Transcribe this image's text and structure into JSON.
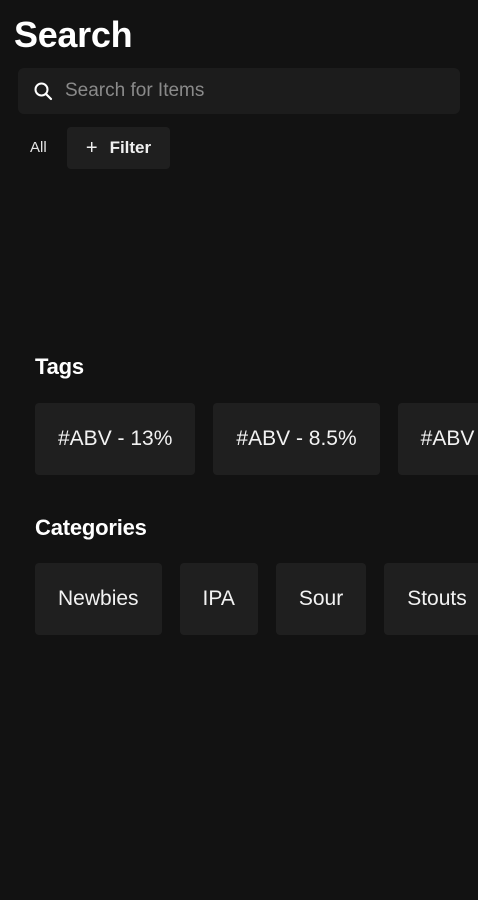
{
  "header": {
    "title": "Search"
  },
  "search": {
    "placeholder": "Search for Items",
    "value": ""
  },
  "filters": {
    "all_label": "All",
    "filter_label": "Filter"
  },
  "tags": {
    "title": "Tags",
    "items": [
      "#ABV - 13%",
      "#ABV - 8.5%",
      "#ABV"
    ]
  },
  "categories": {
    "title": "Categories",
    "items": [
      "Newbies",
      "IPA",
      "Sour",
      "Stouts"
    ]
  },
  "colors": {
    "background": "#121212",
    "surface": "#1f1f1f",
    "text": "#ffffff",
    "placeholder": "#8a8a8a"
  }
}
